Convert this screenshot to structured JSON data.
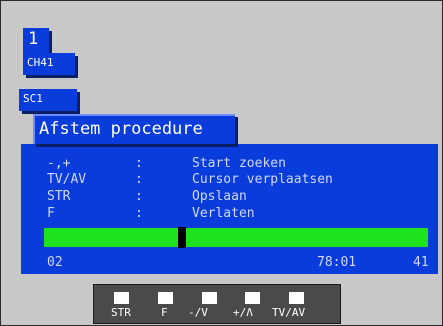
{
  "osd": {
    "channel_number": "1",
    "channel_label": "CH41",
    "source_label": "SC1",
    "title": "Afstem procedure"
  },
  "menu": {
    "separator": ":",
    "items": [
      {
        "key": "-,+",
        "desc": "Start zoeken"
      },
      {
        "key": "TV/AV",
        "desc": "Cursor verplaatsen"
      },
      {
        "key": "STR",
        "desc": "Opslaan"
      },
      {
        "key": "F",
        "desc": "Verlaten"
      }
    ]
  },
  "tuning": {
    "position_fraction": 0.36,
    "left_value": "02",
    "frequency": "78:01",
    "right_value": "41",
    "bar_color": "#1ee21e"
  },
  "remote": {
    "buttons": [
      {
        "label": "STR"
      },
      {
        "label": "F"
      },
      {
        "label": "-/V"
      },
      {
        "label": "+/Λ"
      },
      {
        "label": "TV/AV"
      }
    ]
  },
  "colors": {
    "background": "#c8c8c8",
    "osd_blue": "#0a3cdc",
    "remote_body": "#4a4a4a"
  }
}
